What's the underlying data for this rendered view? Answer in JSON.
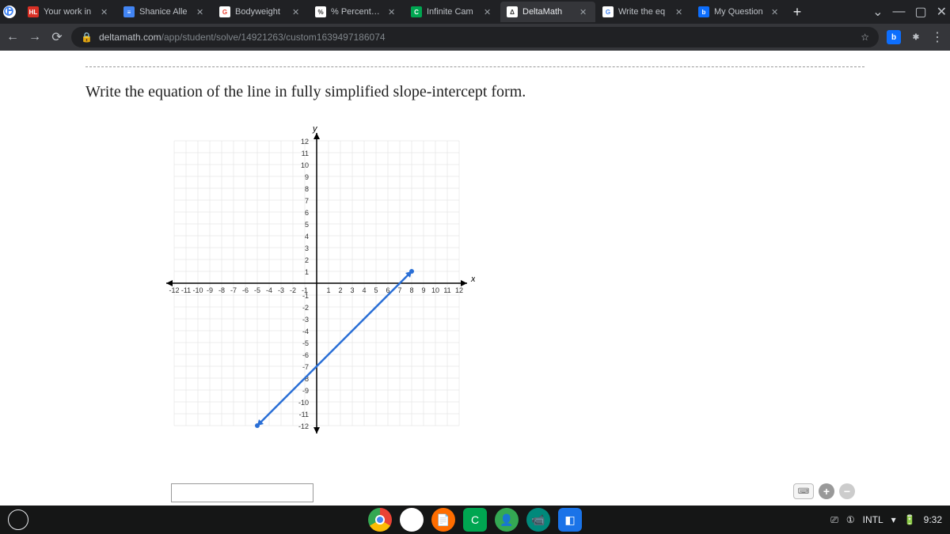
{
  "tabs": [
    {
      "title": "Your work in",
      "favbg": "#d93025",
      "favtxt": "HL"
    },
    {
      "title": "Shanice Alle",
      "favbg": "#4285f4",
      "favtxt": "≡"
    },
    {
      "title": "Bodyweight",
      "favbg": "#ea4335",
      "favtxt": "G"
    },
    {
      "title": "% Percentage",
      "favbg": "#fff",
      "favtxt": "%"
    },
    {
      "title": "Infinite Cam",
      "favbg": "#00a651",
      "favtxt": "C"
    },
    {
      "title": "DeltaMath",
      "favbg": "#fff",
      "favtxt": "Δ",
      "active": true
    },
    {
      "title": "Write the eq",
      "favbg": "#fff",
      "favtxt": "G"
    },
    {
      "title": "My Question",
      "favbg": "#0d6efd",
      "favtxt": "b"
    }
  ],
  "url": {
    "domain": "deltamath.com",
    "path": "/app/student/solve/14921263/custom1639497186074"
  },
  "question": "Write the equation of the line in fully simplified slope-intercept form.",
  "chart_data": {
    "type": "line",
    "title": "",
    "xlabel": "x",
    "ylabel": "y",
    "xlim": [
      -12,
      12
    ],
    "ylim": [
      -12,
      12
    ],
    "series": [
      {
        "name": "line",
        "x": [
          -5,
          8
        ],
        "y": [
          -12,
          1
        ]
      }
    ],
    "line_equation_implied": {
      "slope": 1,
      "intercept": -7
    }
  },
  "status": {
    "intl": "INTL",
    "time": "9:32"
  }
}
